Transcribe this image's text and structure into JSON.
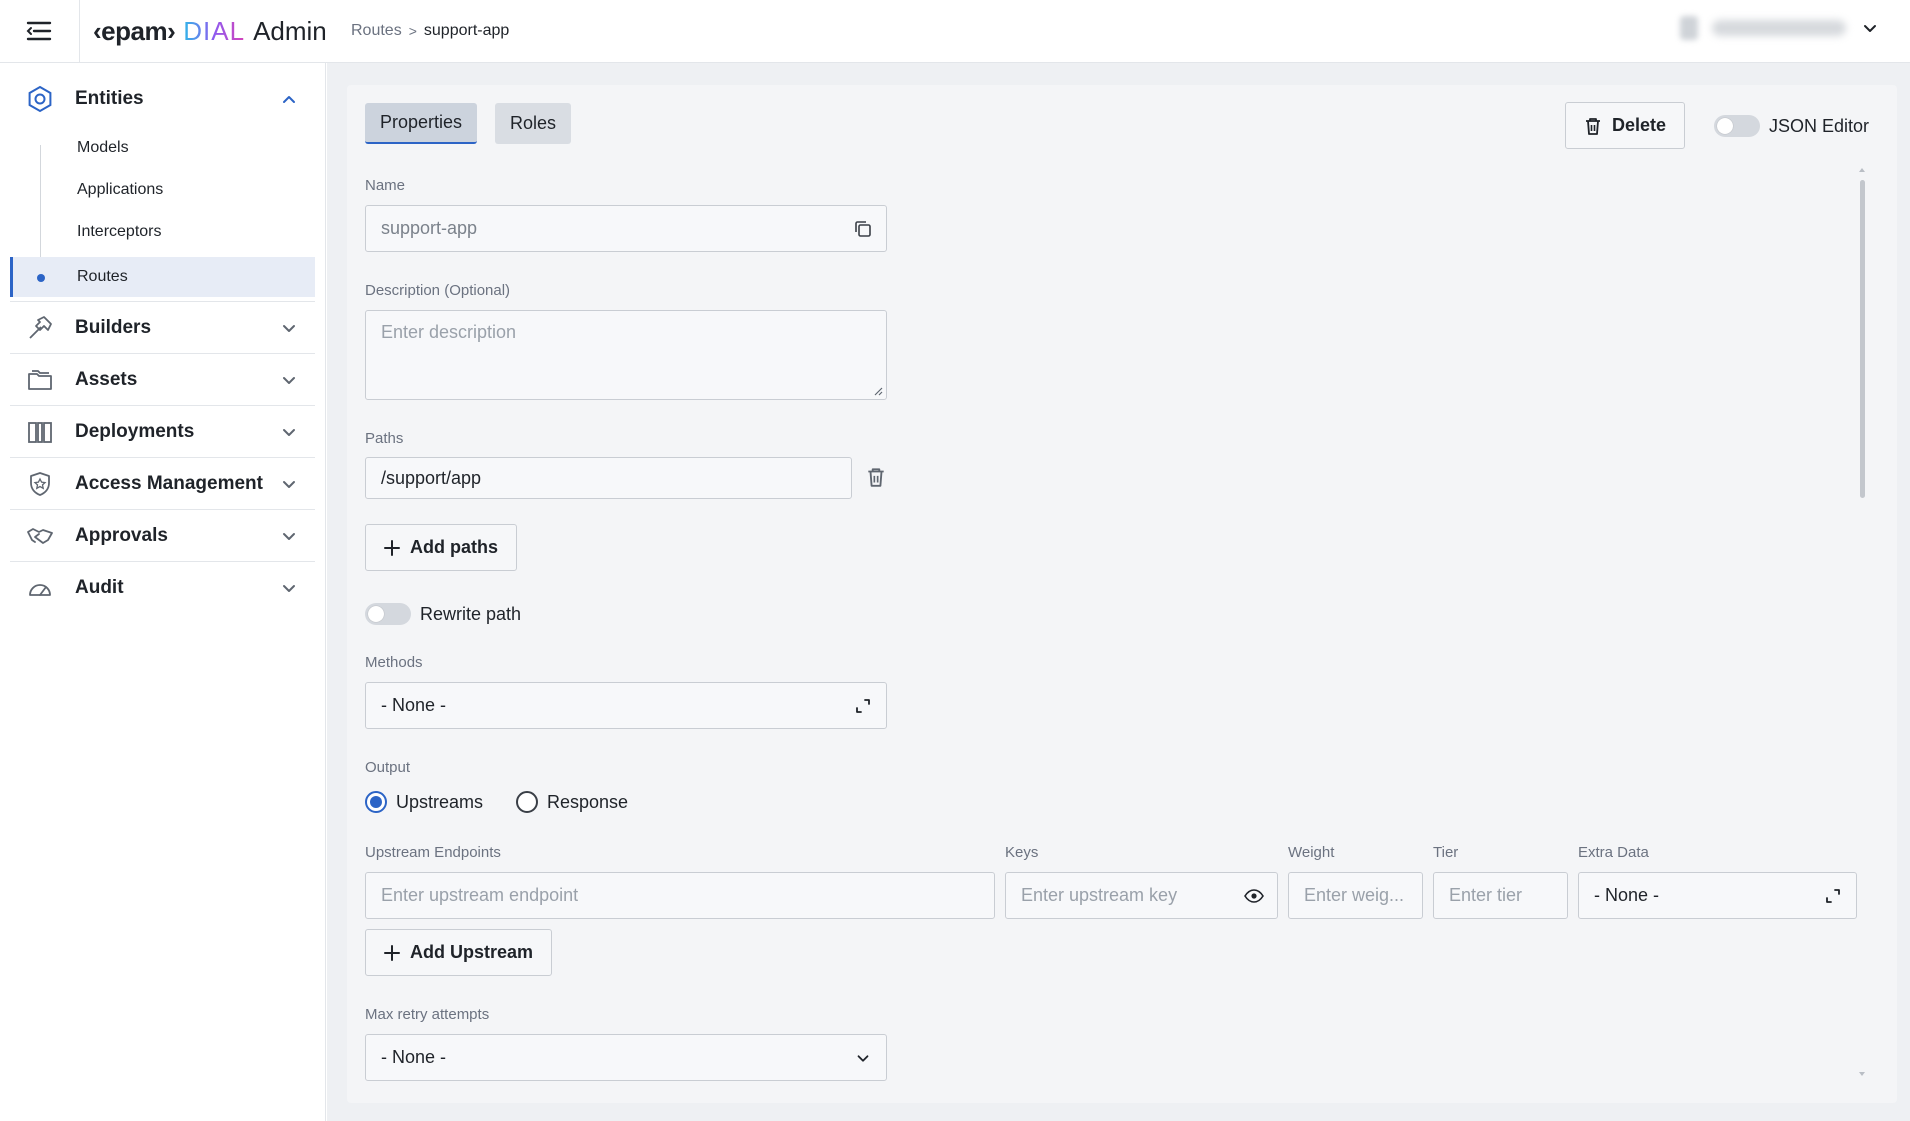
{
  "app": {
    "brand_logo": "‹epam›",
    "brand_dial": "DIAL",
    "brand_admin": "Admin"
  },
  "breadcrumb": {
    "parent": "Routes",
    "separator": ">",
    "current": "support-app"
  },
  "sidebar": {
    "entities": {
      "label": "Entities",
      "children": [
        "Models",
        "Applications",
        "Interceptors",
        "Routes"
      ],
      "active_child": "Routes"
    },
    "groups": [
      "Builders",
      "Assets",
      "Deployments",
      "Access Management",
      "Approvals",
      "Audit"
    ]
  },
  "tabs": [
    {
      "label": "Properties",
      "active": true
    },
    {
      "label": "Roles",
      "active": false
    }
  ],
  "toolbar": {
    "delete_label": "Delete",
    "json_editor_label": "JSON Editor",
    "json_editor_on": false
  },
  "form": {
    "name": {
      "label": "Name",
      "value": "support-app"
    },
    "description": {
      "label": "Description (Optional)",
      "placeholder": "Enter description"
    },
    "paths": {
      "label": "Paths",
      "value": "/support/app",
      "add_label": "Add paths"
    },
    "rewrite_path": {
      "label": "Rewrite path",
      "on": false
    },
    "methods": {
      "label": "Methods",
      "value": "- None -"
    },
    "output": {
      "label": "Output",
      "options": [
        "Upstreams",
        "Response"
      ],
      "selected": "Upstreams"
    },
    "upstreams": {
      "endpoint_label": "Upstream Endpoints",
      "endpoint_placeholder": "Enter upstream endpoint",
      "keys_label": "Keys",
      "keys_placeholder": "Enter upstream key",
      "weight_label": "Weight",
      "weight_placeholder": "Enter weig...",
      "tier_label": "Tier",
      "tier_placeholder": "Enter tier",
      "extra_label": "Extra Data",
      "extra_value": "- None -",
      "add_label": "Add Upstream"
    },
    "max_retry": {
      "label": "Max retry attempts",
      "value": "- None -"
    }
  },
  "colors": {
    "accent": "#2c64c6",
    "panel_bg": "#f4f5f7",
    "border": "#c9cdd3"
  }
}
